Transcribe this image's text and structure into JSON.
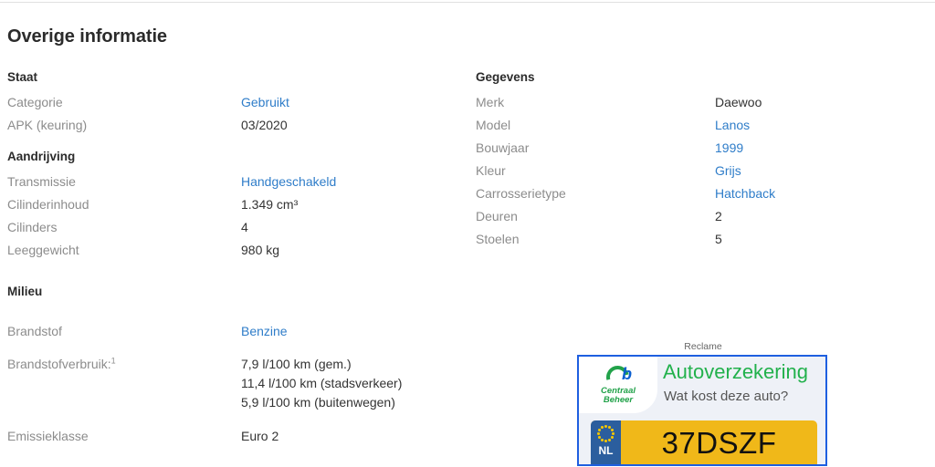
{
  "page_title": "Overige informatie",
  "left_column": [
    {
      "title": "Staat",
      "rows": [
        {
          "label": "Categorie",
          "value": "Gebruikt",
          "link": true
        },
        {
          "label": "APK (keuring)",
          "value": "03/2020",
          "link": false
        }
      ]
    },
    {
      "title": "Aandrijving",
      "rows": [
        {
          "label": "Transmissie",
          "value": "Handgeschakeld",
          "link": true
        },
        {
          "label": "Cilinderinhoud",
          "value": "1.349 cm³",
          "link": false
        },
        {
          "label": "Cilinders",
          "value": "4",
          "link": false
        },
        {
          "label": "Leeggewicht",
          "value": "980 kg",
          "link": false
        }
      ]
    },
    {
      "title": "Milieu",
      "rows": [
        {
          "label": "Brandstof",
          "value": "Benzine",
          "link": true
        },
        {
          "label": "Brandstofverbruik:",
          "label_sup": "1",
          "values": [
            "7,9 l/100 km (gem.)",
            "11,4 l/100 km (stadsverkeer)",
            "5,9 l/100 km (buitenwegen)"
          ],
          "link": false
        },
        {
          "label": "Emissieklasse",
          "value": "Euro 2",
          "link": false
        }
      ]
    }
  ],
  "right_column": [
    {
      "title": "Gegevens",
      "rows": [
        {
          "label": "Merk",
          "value": "Daewoo",
          "link": false
        },
        {
          "label": "Model",
          "value": "Lanos",
          "link": true
        },
        {
          "label": "Bouwjaar",
          "value": "1999",
          "link": true
        },
        {
          "label": "Kleur",
          "value": "Grijs",
          "link": true
        },
        {
          "label": "Carrosserietype",
          "value": "Hatchback",
          "link": true
        },
        {
          "label": "Deuren",
          "value": "2",
          "link": false
        },
        {
          "label": "Stoelen",
          "value": "5",
          "link": false
        }
      ]
    }
  ],
  "ad": {
    "label": "Reclame",
    "logo_line1": "Centraal",
    "logo_line2": "Beheer",
    "logo_mark": "b",
    "headline": "Autoverzekering",
    "subline": "Wat kost deze auto?",
    "plate_country": "NL",
    "plate_number": "37DSZF"
  },
  "colors": {
    "link": "#2f7dc9",
    "label": "#8c8c8c",
    "text": "#333333",
    "ad_border": "#1e5fe0",
    "ad_green": "#22b14c",
    "plate_yellow": "#f0b819",
    "plate_blue": "#2b5e9e"
  }
}
